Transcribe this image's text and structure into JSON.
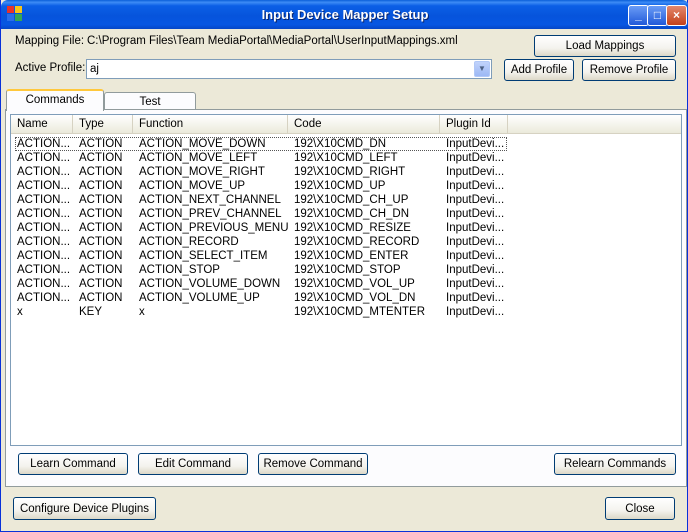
{
  "window": {
    "title": "Input Device Mapper Setup",
    "minimize": "_",
    "maximize": "□",
    "close": "×"
  },
  "mapping": {
    "label": "Mapping File:",
    "path": "C:\\Program Files\\Team MediaPortal\\MediaPortal\\UserInputMappings.xml",
    "load_button": "Load Mappings"
  },
  "profile": {
    "label": "Active Profile:",
    "value": "aj",
    "add_button": "Add Profile",
    "remove_button": "Remove Profile"
  },
  "tabs": [
    {
      "label": "Commands",
      "active": true
    },
    {
      "label": "Test",
      "active": false
    }
  ],
  "list": {
    "columns": [
      "Name",
      "Type",
      "Function",
      "Code",
      "Plugin Id"
    ],
    "rows": [
      [
        "ACTION...",
        "ACTION",
        "ACTION_MOVE_DOWN",
        "192\\X10CMD_DN",
        "InputDevi..."
      ],
      [
        "ACTION...",
        "ACTION",
        "ACTION_MOVE_LEFT",
        "192\\X10CMD_LEFT",
        "InputDevi..."
      ],
      [
        "ACTION...",
        "ACTION",
        "ACTION_MOVE_RIGHT",
        "192\\X10CMD_RIGHT",
        "InputDevi..."
      ],
      [
        "ACTION...",
        "ACTION",
        "ACTION_MOVE_UP",
        "192\\X10CMD_UP",
        "InputDevi..."
      ],
      [
        "ACTION...",
        "ACTION",
        "ACTION_NEXT_CHANNEL",
        "192\\X10CMD_CH_UP",
        "InputDevi..."
      ],
      [
        "ACTION...",
        "ACTION",
        "ACTION_PREV_CHANNEL",
        "192\\X10CMD_CH_DN",
        "InputDevi..."
      ],
      [
        "ACTION...",
        "ACTION",
        "ACTION_PREVIOUS_MENU",
        "192\\X10CMD_RESIZE",
        "InputDevi..."
      ],
      [
        "ACTION...",
        "ACTION",
        "ACTION_RECORD",
        "192\\X10CMD_RECORD",
        "InputDevi..."
      ],
      [
        "ACTION...",
        "ACTION",
        "ACTION_SELECT_ITEM",
        "192\\X10CMD_ENTER",
        "InputDevi..."
      ],
      [
        "ACTION...",
        "ACTION",
        "ACTION_STOP",
        "192\\X10CMD_STOP",
        "InputDevi..."
      ],
      [
        "ACTION...",
        "ACTION",
        "ACTION_VOLUME_DOWN",
        "192\\X10CMD_VOL_UP",
        "InputDevi..."
      ],
      [
        "ACTION...",
        "ACTION",
        "ACTION_VOLUME_UP",
        "192\\X10CMD_VOL_DN",
        "InputDevi..."
      ],
      [
        "x",
        "KEY",
        "x",
        "192\\X10CMD_MTENTER",
        "InputDevi..."
      ]
    ]
  },
  "commands": {
    "learn": "Learn Command",
    "edit": "Edit Command",
    "remove": "Remove Command",
    "relearn": "Relearn Commands"
  },
  "footer": {
    "configure": "Configure Device Plugins",
    "close": "Close"
  }
}
